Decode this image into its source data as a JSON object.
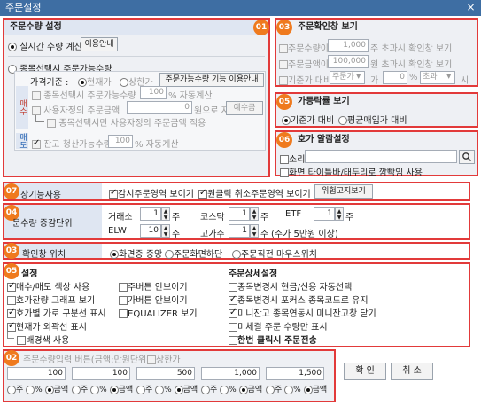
{
  "window": {
    "title": "주문설정",
    "close": "×"
  },
  "s01": {
    "badge": "01",
    "title": "주문수량 설정",
    "radio_realtime": "실시간 수량 계산",
    "guide_btn": "이용안내",
    "radio_item": "종목선택시 주문가능수량",
    "price_basis": "가격기준 :",
    "r_current": "현재가",
    "r_upper": "상한가",
    "item_btn": "주문가능수량 기능 이용안내",
    "side_buy": "매수",
    "side_sell": "매도",
    "row1_label": "종목선택시 주문가능수량",
    "row1_value": "100",
    "row1_suffix": "% 자동계산",
    "row2_label": "사용자정의 주문금액",
    "row2_value": "0",
    "row2_suffix": "원으로 자동계산",
    "row2_btn": "예수금",
    "row3_label": "종목선택시만 사용자정의 주문금액 적용",
    "sell_label": "잔고 청산가능수량",
    "sell_value": "100",
    "sell_suffix": "% 자동계산"
  },
  "s03": {
    "badge": "03",
    "title": "주문확인창 보기",
    "q_label": "주문수량이",
    "q_value": "1,000",
    "q_suffix": "주 초과시 확인창 보기",
    "a_label": "주문금액이",
    "a_value": "100,000",
    "a_suffix": "원 초과시 확인창 보기",
    "p_label": "기준가 대비",
    "p_select": "주문가",
    "p_mid": "가",
    "p_value": "0",
    "p_unit": "%",
    "p_select2": "초과",
    "p_end": "시"
  },
  "s05b": {
    "badge": "05",
    "title": "가등락률 보기",
    "r1": "기준가 대비",
    "r2": "평균매입가 대비"
  },
  "s06": {
    "badge": "06",
    "title": "호가 알람설정",
    "sound": "소리",
    "search_icon": "magnifier",
    "flash": "화면 타이틀바/태두리로 깜빡임 사용"
  },
  "r07": {
    "badge": "07",
    "label": "장기능사용",
    "c1": "감시주문영역 보이기",
    "c2": "원클릭 취소주문영역 보이기",
    "btn": "위험고지보기"
  },
  "r04": {
    "badge": "04",
    "label": "문수량 증감단위",
    "kospi_label": "거래소",
    "kospi_value": "1",
    "kosdaq_label": "코스닥",
    "kosdaq_value": "1",
    "etf_label": "ETF",
    "etf_value": "1",
    "elw_label": "ELW",
    "elw_value": "10",
    "konex_label": "고가주",
    "konex_value": "1",
    "unit": "주",
    "konex_note": "(주가 5만원 이상)"
  },
  "r03b": {
    "badge": "03",
    "label": "확인창 위치",
    "r1": "화면중 중앙",
    "r2": "주문화면하단",
    "r3": "주문직전 마우스위치"
  },
  "s05": {
    "badge": "05",
    "title_left": "설정",
    "title_right": "주문상세설정",
    "left": [
      {
        "label": "매수/매도 색상 사용",
        "on": true
      },
      {
        "label": "호가잔량 그래프 보기",
        "on": false
      },
      {
        "label": "호가별 가로 구분선 표시",
        "on": true
      },
      {
        "label": "현재가 외곽선 표시",
        "on": true
      },
      {
        "label": "배경색 사용",
        "on": false
      }
    ],
    "mid": [
      {
        "label": "주버튼 안보이기",
        "on": false
      },
      {
        "label": "가버튼 안보이기",
        "on": false
      },
      {
        "label": "EQUALIZER 보기",
        "on": false
      }
    ],
    "right": [
      {
        "label": "종목변경시 현금/신용 자동선택",
        "on": false
      },
      {
        "label": "종목변경시 포커스 종목코드로 유지",
        "on": true
      },
      {
        "label": "미니잔고 종목연동시 미니잔고창 닫기",
        "on": true
      },
      {
        "label": "미체결 주문 수량만 표시",
        "on": false
      },
      {
        "label": "한번 클릭시 주문전송",
        "on": false
      }
    ]
  },
  "s02": {
    "badge": "02",
    "title": "주문수량입력 버튼(금액:만원단위)",
    "upper": "상한가",
    "inputs": [
      "100",
      "100",
      "500",
      "1,000",
      "1,500"
    ],
    "r_qty": "주",
    "r_pct": "%",
    "r_amt": "금액"
  },
  "footer": {
    "ok": "확 인",
    "cancel": "취 소"
  }
}
